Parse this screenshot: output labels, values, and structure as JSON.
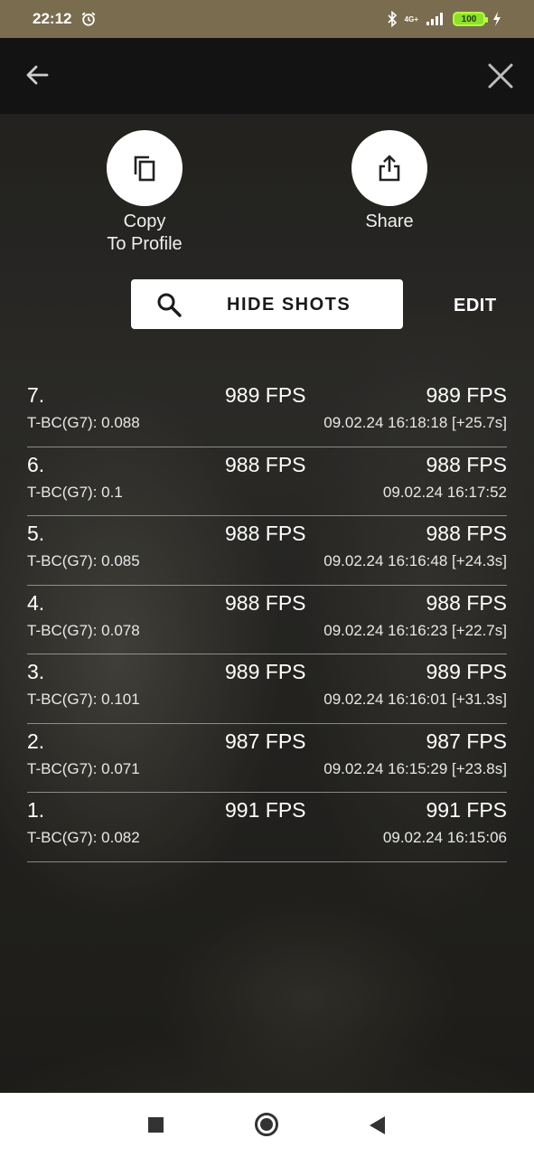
{
  "status_bar": {
    "time": "22:12",
    "network": "4G+",
    "battery": "100",
    "battery_color": "#8ee02a"
  },
  "actions": {
    "copy_label_line1": "Copy",
    "copy_label_line2": "To Profile",
    "share_label": "Share"
  },
  "toolbar": {
    "hide_shots_label": "HIDE SHOTS",
    "edit_label": "EDIT"
  },
  "shots": [
    {
      "num": "7.",
      "fps_a": "989 FPS",
      "fps_b": "989 FPS",
      "bc": "T-BC(G7): 0.088",
      "timestamp": "09.02.24 16:18:18 [+25.7s]"
    },
    {
      "num": "6.",
      "fps_a": "988 FPS",
      "fps_b": "988 FPS",
      "bc": "T-BC(G7): 0.1",
      "timestamp": "09.02.24 16:17:52"
    },
    {
      "num": "5.",
      "fps_a": "988 FPS",
      "fps_b": "988 FPS",
      "bc": "T-BC(G7): 0.085",
      "timestamp": "09.02.24 16:16:48 [+24.3s]"
    },
    {
      "num": "4.",
      "fps_a": "988 FPS",
      "fps_b": "988 FPS",
      "bc": "T-BC(G7): 0.078",
      "timestamp": "09.02.24 16:16:23 [+22.7s]"
    },
    {
      "num": "3.",
      "fps_a": "989 FPS",
      "fps_b": "989 FPS",
      "bc": "T-BC(G7): 0.101",
      "timestamp": "09.02.24 16:16:01 [+31.3s]"
    },
    {
      "num": "2.",
      "fps_a": "987 FPS",
      "fps_b": "987 FPS",
      "bc": "T-BC(G7): 0.071",
      "timestamp": "09.02.24 16:15:29 [+23.8s]"
    },
    {
      "num": "1.",
      "fps_a": "991 FPS",
      "fps_b": "991 FPS",
      "bc": "T-BC(G7): 0.082",
      "timestamp": "09.02.24 16:15:06"
    }
  ],
  "icons": {
    "back": "arrow-left-icon",
    "close": "close-icon",
    "copy": "copy-icon",
    "share": "share-icon",
    "search": "search-icon"
  }
}
